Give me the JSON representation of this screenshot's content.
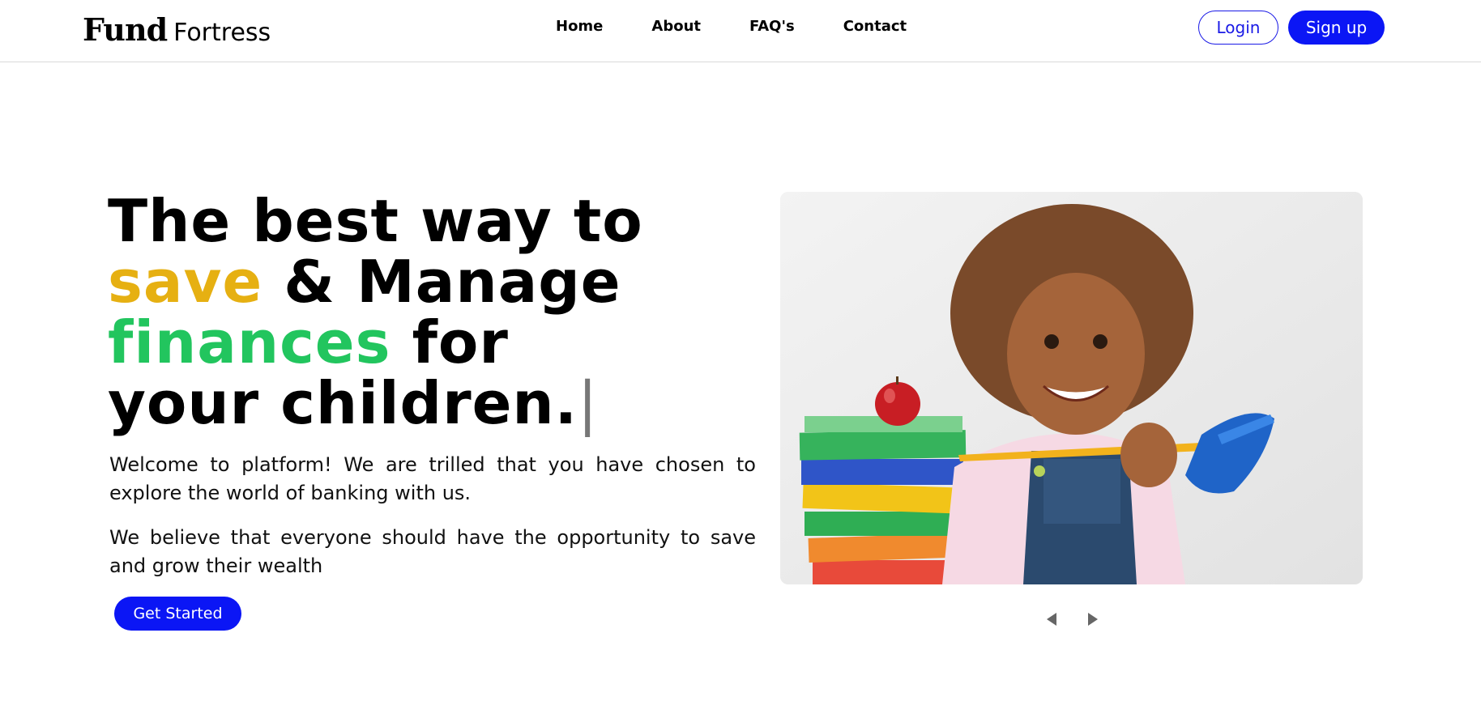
{
  "nav": {
    "logo_bold": "Fund",
    "logo_light": "Fortress",
    "links": [
      "Home",
      "About",
      "FAQ's",
      "Contact"
    ],
    "login_label": "Login",
    "signup_label": "Sign up"
  },
  "hero": {
    "headline": {
      "part1": "The best way to",
      "save_word": "save",
      "part2": "& Manage",
      "finances_word": "finances",
      "part3": "for",
      "part4": "your children.",
      "cursor": "|"
    },
    "paragraph1": "Welcome to platform! We are trilled that you have chosen to explore the world of banking with us.",
    "paragraph2": "We believe that everyone should have the opportunity to save and grow their wealth",
    "cta_label": "Get Started"
  },
  "carousel": {
    "prev_icon": "caret-left-icon",
    "next_icon": "caret-right-icon"
  },
  "colors": {
    "primary": "#0b16f5",
    "save_yellow": "#e6b012",
    "finances_green": "#22c55e"
  }
}
